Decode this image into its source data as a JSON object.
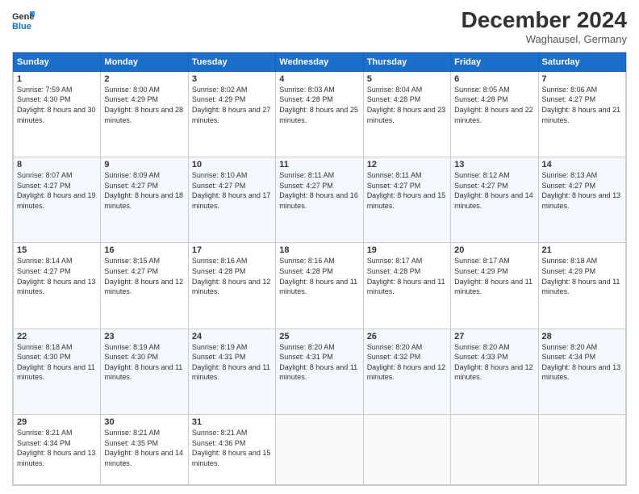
{
  "logo": {
    "general": "General",
    "blue": "Blue"
  },
  "header": {
    "month": "December 2024",
    "location": "Waghausel, Germany"
  },
  "days_of_week": [
    "Sunday",
    "Monday",
    "Tuesday",
    "Wednesday",
    "Thursday",
    "Friday",
    "Saturday"
  ],
  "weeks": [
    [
      {
        "day": 1,
        "sunrise": "7:59 AM",
        "sunset": "4:30 PM",
        "daylight": "8 hours and 30 minutes."
      },
      {
        "day": 2,
        "sunrise": "8:00 AM",
        "sunset": "4:29 PM",
        "daylight": "8 hours and 28 minutes."
      },
      {
        "day": 3,
        "sunrise": "8:02 AM",
        "sunset": "4:29 PM",
        "daylight": "8 hours and 27 minutes."
      },
      {
        "day": 4,
        "sunrise": "8:03 AM",
        "sunset": "4:28 PM",
        "daylight": "8 hours and 25 minutes."
      },
      {
        "day": 5,
        "sunrise": "8:04 AM",
        "sunset": "4:28 PM",
        "daylight": "8 hours and 23 minutes."
      },
      {
        "day": 6,
        "sunrise": "8:05 AM",
        "sunset": "4:28 PM",
        "daylight": "8 hours and 22 minutes."
      },
      {
        "day": 7,
        "sunrise": "8:06 AM",
        "sunset": "4:27 PM",
        "daylight": "8 hours and 21 minutes."
      }
    ],
    [
      {
        "day": 8,
        "sunrise": "8:07 AM",
        "sunset": "4:27 PM",
        "daylight": "8 hours and 19 minutes."
      },
      {
        "day": 9,
        "sunrise": "8:09 AM",
        "sunset": "4:27 PM",
        "daylight": "8 hours and 18 minutes."
      },
      {
        "day": 10,
        "sunrise": "8:10 AM",
        "sunset": "4:27 PM",
        "daylight": "8 hours and 17 minutes."
      },
      {
        "day": 11,
        "sunrise": "8:11 AM",
        "sunset": "4:27 PM",
        "daylight": "8 hours and 16 minutes."
      },
      {
        "day": 12,
        "sunrise": "8:11 AM",
        "sunset": "4:27 PM",
        "daylight": "8 hours and 15 minutes."
      },
      {
        "day": 13,
        "sunrise": "8:12 AM",
        "sunset": "4:27 PM",
        "daylight": "8 hours and 14 minutes."
      },
      {
        "day": 14,
        "sunrise": "8:13 AM",
        "sunset": "4:27 PM",
        "daylight": "8 hours and 13 minutes."
      }
    ],
    [
      {
        "day": 15,
        "sunrise": "8:14 AM",
        "sunset": "4:27 PM",
        "daylight": "8 hours and 13 minutes."
      },
      {
        "day": 16,
        "sunrise": "8:15 AM",
        "sunset": "4:27 PM",
        "daylight": "8 hours and 12 minutes."
      },
      {
        "day": 17,
        "sunrise": "8:16 AM",
        "sunset": "4:28 PM",
        "daylight": "8 hours and 12 minutes."
      },
      {
        "day": 18,
        "sunrise": "8:16 AM",
        "sunset": "4:28 PM",
        "daylight": "8 hours and 11 minutes."
      },
      {
        "day": 19,
        "sunrise": "8:17 AM",
        "sunset": "4:28 PM",
        "daylight": "8 hours and 11 minutes."
      },
      {
        "day": 20,
        "sunrise": "8:17 AM",
        "sunset": "4:29 PM",
        "daylight": "8 hours and 11 minutes."
      },
      {
        "day": 21,
        "sunrise": "8:18 AM",
        "sunset": "4:29 PM",
        "daylight": "8 hours and 11 minutes."
      }
    ],
    [
      {
        "day": 22,
        "sunrise": "8:18 AM",
        "sunset": "4:30 PM",
        "daylight": "8 hours and 11 minutes."
      },
      {
        "day": 23,
        "sunrise": "8:19 AM",
        "sunset": "4:30 PM",
        "daylight": "8 hours and 11 minutes."
      },
      {
        "day": 24,
        "sunrise": "8:19 AM",
        "sunset": "4:31 PM",
        "daylight": "8 hours and 11 minutes."
      },
      {
        "day": 25,
        "sunrise": "8:20 AM",
        "sunset": "4:31 PM",
        "daylight": "8 hours and 11 minutes."
      },
      {
        "day": 26,
        "sunrise": "8:20 AM",
        "sunset": "4:32 PM",
        "daylight": "8 hours and 12 minutes."
      },
      {
        "day": 27,
        "sunrise": "8:20 AM",
        "sunset": "4:33 PM",
        "daylight": "8 hours and 12 minutes."
      },
      {
        "day": 28,
        "sunrise": "8:20 AM",
        "sunset": "4:34 PM",
        "daylight": "8 hours and 13 minutes."
      }
    ],
    [
      {
        "day": 29,
        "sunrise": "8:21 AM",
        "sunset": "4:34 PM",
        "daylight": "8 hours and 13 minutes."
      },
      {
        "day": 30,
        "sunrise": "8:21 AM",
        "sunset": "4:35 PM",
        "daylight": "8 hours and 14 minutes."
      },
      {
        "day": 31,
        "sunrise": "8:21 AM",
        "sunset": "4:36 PM",
        "daylight": "8 hours and 15 minutes."
      },
      null,
      null,
      null,
      null
    ]
  ]
}
